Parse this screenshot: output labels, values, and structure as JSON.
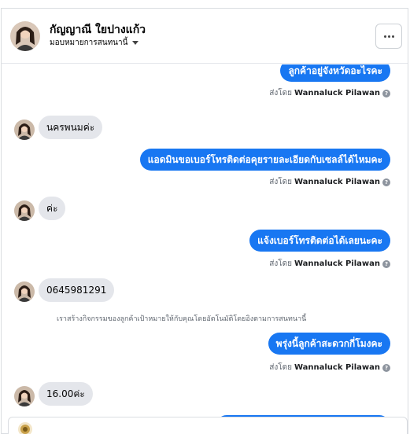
{
  "header": {
    "name": "กัญญาณี ใยปางแก้ว",
    "assign_label": "มอบหมายการสนทนานี้",
    "more_icon": "more-horizontal-icon"
  },
  "sent_by": {
    "prefix": "ส่งโดย",
    "agent": "Wannaluck Pilawan",
    "help_icon": "?"
  },
  "messages": [
    {
      "from": "page",
      "text": "ลูกค้าอยู่จังหวัดอะไรคะ"
    },
    {
      "from": "customer",
      "text": "นครพนมค่ะ"
    },
    {
      "from": "page",
      "text": "แอดมินขอเบอร์โทรติดต่อคุยรายละเอียดกับเซลล์ได้ไหมคะ"
    },
    {
      "from": "customer",
      "text": "ค่ะ"
    },
    {
      "from": "page",
      "text": "แจ้งเบอร์โทรติดต่อได้เลยนะคะ"
    },
    {
      "from": "customer",
      "text": "0645981291"
    },
    {
      "from": "page",
      "text": "พรุ่งนี้ลูกค้าสะดวกกี่โมงคะ"
    },
    {
      "from": "customer",
      "text": "16.00ค่ะ"
    }
  ],
  "system_note": "เราสร้างกิจกรรมของลูกค้าเป้าหมายให้กับคุณโดยอัตโนมัติโดยอิงตามการสนทนานี้",
  "colors": {
    "outgoing_bubble": "#1877f2",
    "incoming_bubble": "#e4e6eb",
    "meta_text": "#606770"
  }
}
